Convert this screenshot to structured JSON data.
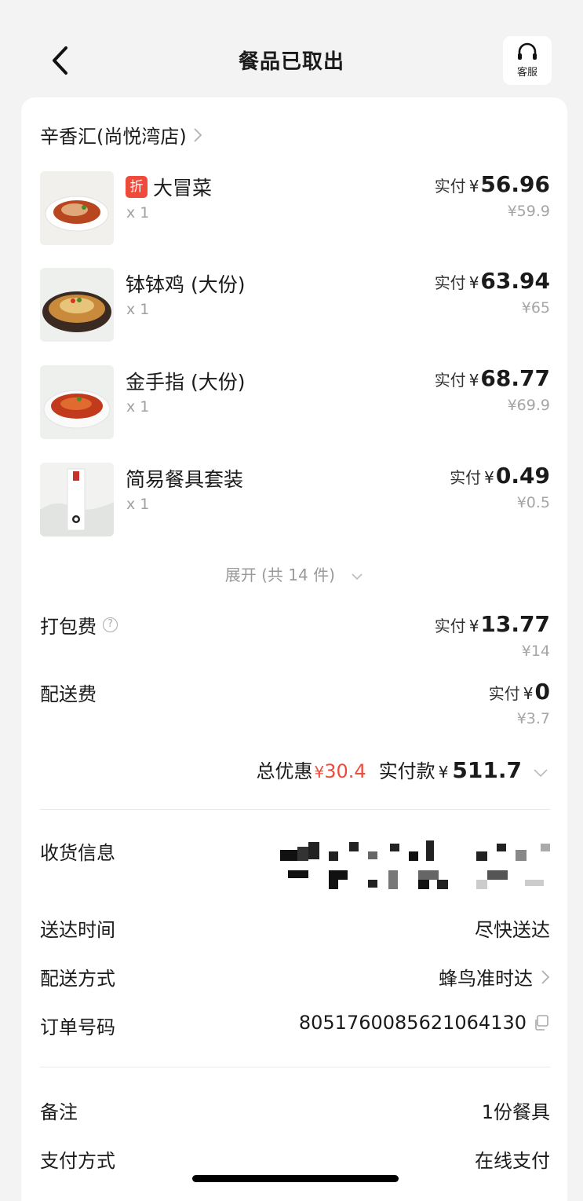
{
  "header": {
    "title": "餐品已取出",
    "service_label": "客服"
  },
  "store": {
    "name": "辛香汇(尚悦湾店)"
  },
  "items": [
    {
      "name": "大冒菜",
      "discount_tag": "折",
      "qty": "x 1",
      "paid_prefix": "实付",
      "currency": "¥",
      "paid": "56.96",
      "original": "¥59.9"
    },
    {
      "name": "钵钵鸡 (大份)",
      "qty": "x 1",
      "paid_prefix": "实付",
      "currency": "¥",
      "paid": "63.94",
      "original": "¥65"
    },
    {
      "name": "金手指 (大份)",
      "qty": "x 1",
      "paid_prefix": "实付",
      "currency": "¥",
      "paid": "68.77",
      "original": "¥69.9"
    },
    {
      "name": "简易餐具套装",
      "qty": "x 1",
      "paid_prefix": "实付",
      "currency": "¥",
      "paid": "0.49",
      "original": "¥0.5"
    }
  ],
  "expand": {
    "label": "展开 (共 14 件)"
  },
  "fees": {
    "packing": {
      "label": "打包费",
      "paid_prefix": "实付",
      "currency": "¥",
      "paid": "13.77",
      "original": "¥14"
    },
    "delivery": {
      "label": "配送费",
      "paid_prefix": "实付",
      "currency": "¥",
      "paid": "0",
      "original": "¥3.7"
    }
  },
  "summary": {
    "discount_label": "总优惠",
    "discount_currency": "¥",
    "discount": "30.4",
    "paid_label": "实付款",
    "paid_currency": "¥",
    "paid": "511.7"
  },
  "info": {
    "address_label": "收货信息",
    "time_label": "送达时间",
    "time_value": "尽快送达",
    "method_label": "配送方式",
    "method_value": "蜂鸟准时达",
    "order_label": "订单号码",
    "order_value": "8051760085621064130",
    "note_label": "备注",
    "note_value": "1份餐具",
    "pay_label": "支付方式",
    "pay_value": "在线支付"
  },
  "colors": {
    "accent_red": "#ef4b3c",
    "page_bg": "#f3f3f3"
  }
}
